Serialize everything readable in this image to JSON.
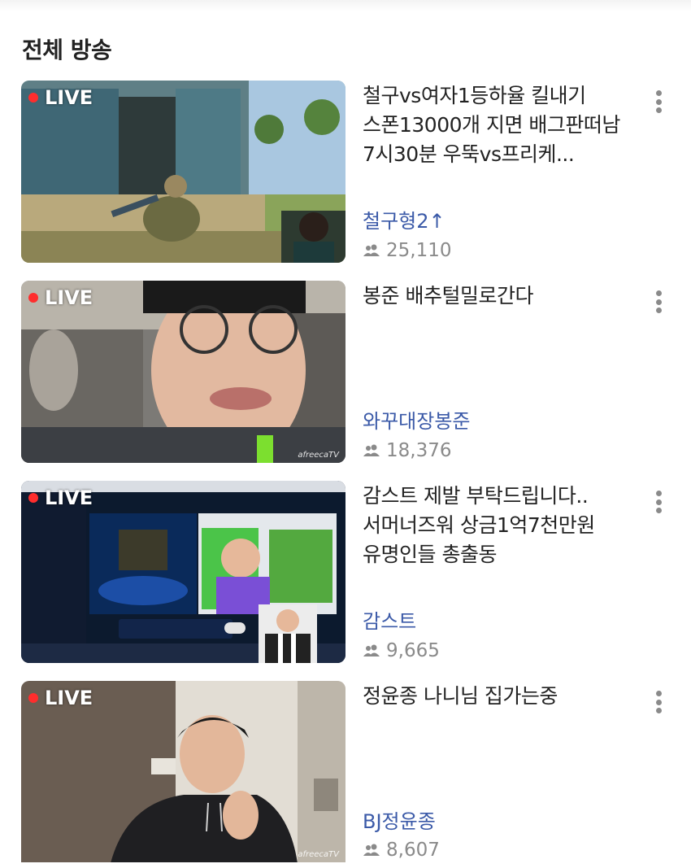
{
  "section": {
    "title": "전체 방송"
  },
  "live_label": "LIVE",
  "watermark": "afreecaTV",
  "colors": {
    "live_dot": "#ff2d2d",
    "channel_link": "#3b5aa8",
    "meta_gray": "#8a8a8a",
    "title_text": "#222222"
  },
  "streams": [
    {
      "title": "철구vs여자1등하율 킬내기 스폰13000개 지면 배그판떠남 7시30분 우뚝vs프리케...",
      "channel": "철구형2↑",
      "viewers": "25,110"
    },
    {
      "title": "봉준 배추털밀로간다",
      "channel": "와꾸대장봉준",
      "viewers": "18,376"
    },
    {
      "title": "감스트 제발 부탁드립니다.. 서머너즈워 상금1억7천만원 유명인들 총출동",
      "channel": "감스트",
      "viewers": "9,665"
    },
    {
      "title": "정윤종 나니님 집가는중",
      "channel": "BJ정윤종",
      "viewers": "8,607"
    }
  ]
}
